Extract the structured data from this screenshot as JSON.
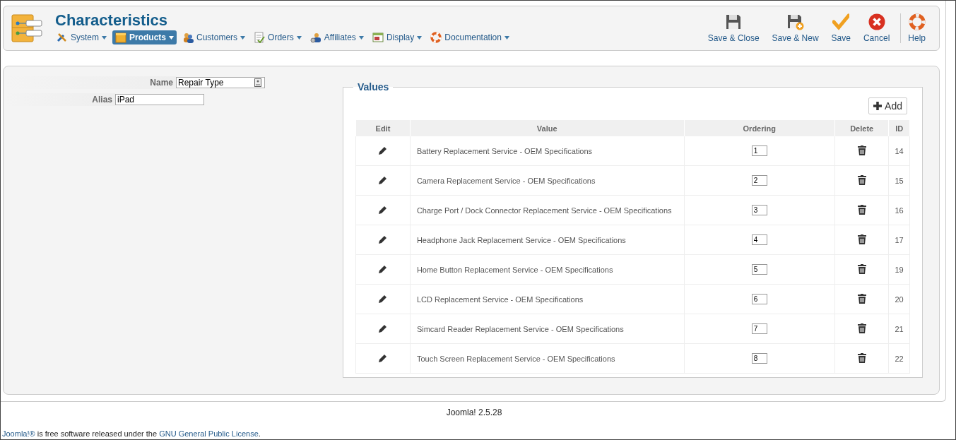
{
  "header": {
    "title": "Characteristics"
  },
  "menu": [
    {
      "label": "System",
      "kind": "tools",
      "selected": false
    },
    {
      "label": "Products",
      "kind": "box",
      "selected": true
    },
    {
      "label": "Customers",
      "kind": "people",
      "selected": false
    },
    {
      "label": "Orders",
      "kind": "document",
      "selected": false
    },
    {
      "label": "Affiliates",
      "kind": "affiliates",
      "selected": false
    },
    {
      "label": "Display",
      "kind": "window",
      "selected": false
    },
    {
      "label": "Documentation",
      "kind": "lifebuoy",
      "selected": false
    }
  ],
  "toolbar": [
    {
      "label": "Save & Close",
      "kind": "disk"
    },
    {
      "label": "Save & New",
      "kind": "disk-plus"
    },
    {
      "label": "Save",
      "kind": "check"
    },
    {
      "label": "Cancel",
      "kind": "cancel"
    },
    {
      "label": "Help",
      "kind": "lifebuoy"
    }
  ],
  "form": {
    "name": {
      "label": "Name",
      "value": "Repair Type"
    },
    "alias": {
      "label": "Alias",
      "value": "iPad"
    }
  },
  "values": {
    "legend": "Values",
    "add_button": "Add",
    "columns": [
      "Edit",
      "Value",
      "Ordering",
      "Delete",
      "ID"
    ],
    "rows": [
      {
        "value": "Battery Replacement Service - OEM Specifications",
        "ordering": "1",
        "id": "14"
      },
      {
        "value": "Camera Replacement Service - OEM Specifications",
        "ordering": "2",
        "id": "15"
      },
      {
        "value": "Charge Port / Dock Connector Replacement Service - OEM Specifications",
        "ordering": "3",
        "id": "16"
      },
      {
        "value": "Headphone Jack Replacement Service - OEM Specifications",
        "ordering": "4",
        "id": "17"
      },
      {
        "value": "Home Button Replacement Service - OEM Specifications",
        "ordering": "5",
        "id": "19"
      },
      {
        "value": "LCD Replacement Service - OEM Specifications",
        "ordering": "6",
        "id": "20"
      },
      {
        "value": "Simcard Reader Replacement Service - OEM Specifications",
        "ordering": "7",
        "id": "21"
      },
      {
        "value": "Touch Screen Replacement Service - OEM Specifications",
        "ordering": "8",
        "id": "22"
      }
    ]
  },
  "footer": {
    "version": "Joomla! 2.5.28",
    "license": {
      "link1": "Joomla!®",
      "text": "is free software released under the",
      "link2": "GNU General Public License",
      "end": "."
    }
  }
}
